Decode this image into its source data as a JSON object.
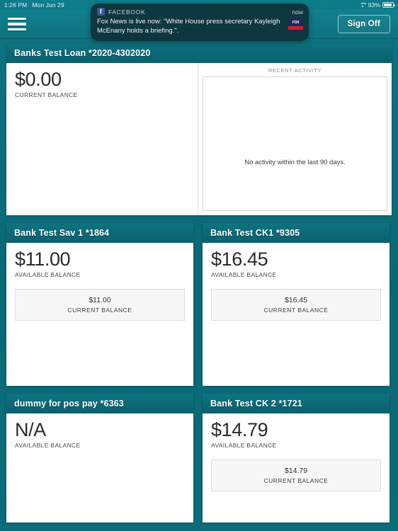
{
  "status_bar": {
    "time": "1:26 PM",
    "date": "Mon Jun 29",
    "wifi_icon": "wifi-icon",
    "battery_percent": "93%",
    "battery_icon": "battery-icon"
  },
  "app_bar": {
    "menu_icon": "hamburger-menu-icon",
    "sign_off_label": "Sign Off"
  },
  "notification": {
    "app_icon": "facebook-icon",
    "app_icon_glyph": "f",
    "app_name": "FACEBOOK",
    "time": "now",
    "message": "Fox News is live now: \"White House press secretary Kayleigh McEnany holds a briefing.\".",
    "thumb_icon": "fox-news-logo-icon",
    "thumb_top_text": "FOX",
    "thumb_bottom_text": "NEWS"
  },
  "accounts": [
    {
      "title": "Banks Test Loan *2020-4302020",
      "balance": "$0.00",
      "balance_label": "CURRENT BALANCE",
      "has_sub": false,
      "has_activity": true,
      "activity_title": "RECENT ACTIVITY",
      "activity_empty": "No activity within the last 90 days."
    },
    {
      "title": "Bank Test Sav 1 *1864",
      "balance": "$11.00",
      "balance_label": "AVAILABLE BALANCE",
      "has_sub": true,
      "sub_amount": "$11.00",
      "sub_label": "CURRENT BALANCE",
      "has_activity": false
    },
    {
      "title": "Bank Test CK1 *9305",
      "balance": "$16.45",
      "balance_label": "AVAILABLE BALANCE",
      "has_sub": true,
      "sub_amount": "$16.45",
      "sub_label": "CURRENT BALANCE",
      "has_activity": false
    },
    {
      "title": "dummy for pos pay *6363",
      "balance": "N/A",
      "balance_label": "AVAILABLE BALANCE",
      "has_sub": false,
      "has_activity": false
    },
    {
      "title": "Bank Test CK 2 *1721",
      "balance": "$14.79",
      "balance_label": "AVAILABLE BALANCE",
      "has_sub": true,
      "sub_amount": "$14.79",
      "sub_label": "CURRENT BALANCE",
      "has_activity": false
    }
  ],
  "colors": {
    "teal_bg": "#0b6e7c",
    "teal_header_top": "#0e7381",
    "teal_header_bottom": "#0a606d",
    "card_white": "#ffffff",
    "facebook_blue": "#3b5998",
    "fox_red": "#cc2127"
  }
}
